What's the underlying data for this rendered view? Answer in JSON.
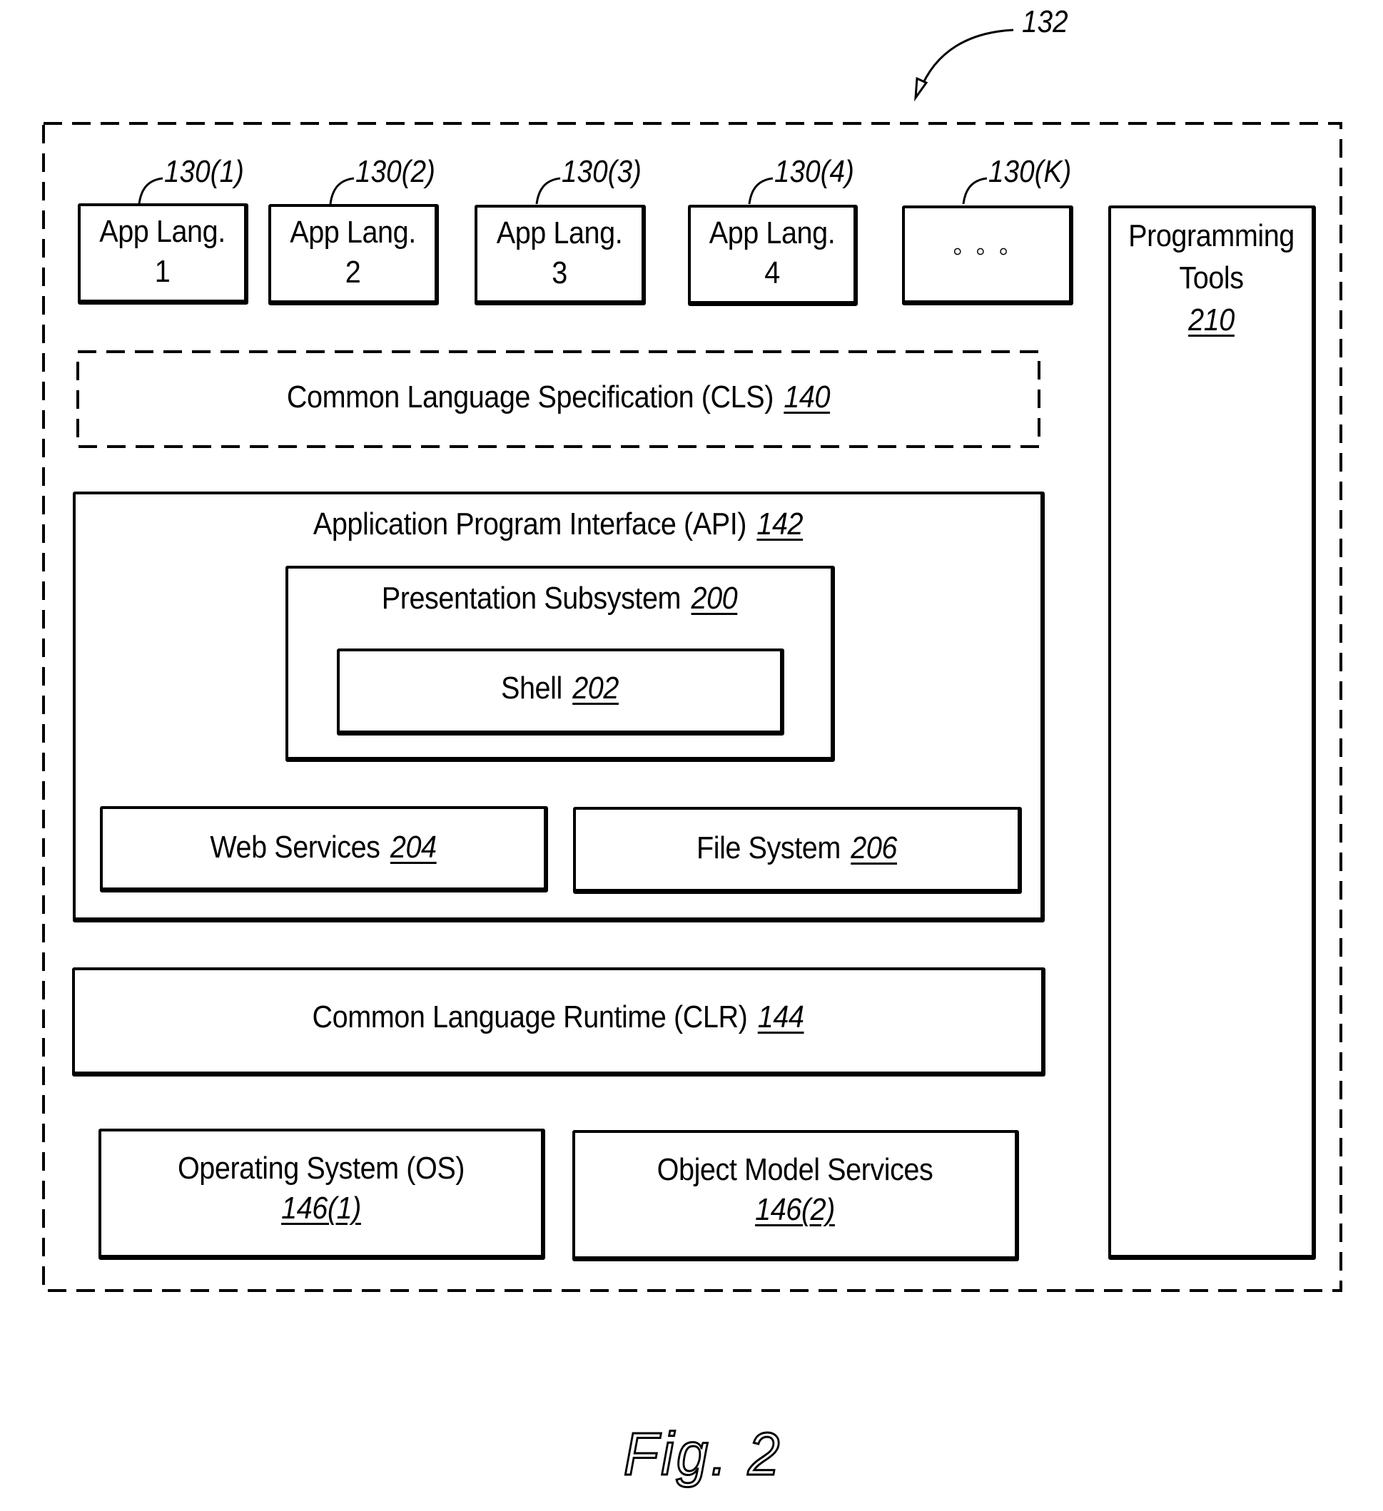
{
  "figure_ref": "132",
  "figure_caption": "Fig. 2",
  "app_languages": [
    {
      "ref": "130(1)",
      "label": "App Lang.",
      "number": "1"
    },
    {
      "ref": "130(2)",
      "label": "App Lang.",
      "number": "2"
    },
    {
      "ref": "130(3)",
      "label": "App Lang.",
      "number": "3"
    },
    {
      "ref": "130(4)",
      "label": "App Lang.",
      "number": "4"
    },
    {
      "ref": "130(K)",
      "label": "",
      "number": "",
      "ellipsis": "◦◦◦"
    }
  ],
  "programming_tools": {
    "label_line1": "Programming",
    "label_line2": "Tools",
    "ref": "210"
  },
  "cls": {
    "label": "Common Language Specification (CLS)",
    "ref": "140"
  },
  "api": {
    "label": "Application Program Interface (API)",
    "ref": "142"
  },
  "presentation": {
    "label": "Presentation Subsystem",
    "ref": "200"
  },
  "shell": {
    "label": "Shell",
    "ref": "202"
  },
  "web_services": {
    "label": "Web Services",
    "ref": "204"
  },
  "file_system": {
    "label": "File System",
    "ref": "206"
  },
  "clr": {
    "label": "Common Language Runtime (CLR)",
    "ref": "144"
  },
  "os": {
    "label": "Operating System (OS)",
    "ref": "146(1)"
  },
  "object_model": {
    "label": "Object Model Services",
    "ref": "146(2)"
  }
}
